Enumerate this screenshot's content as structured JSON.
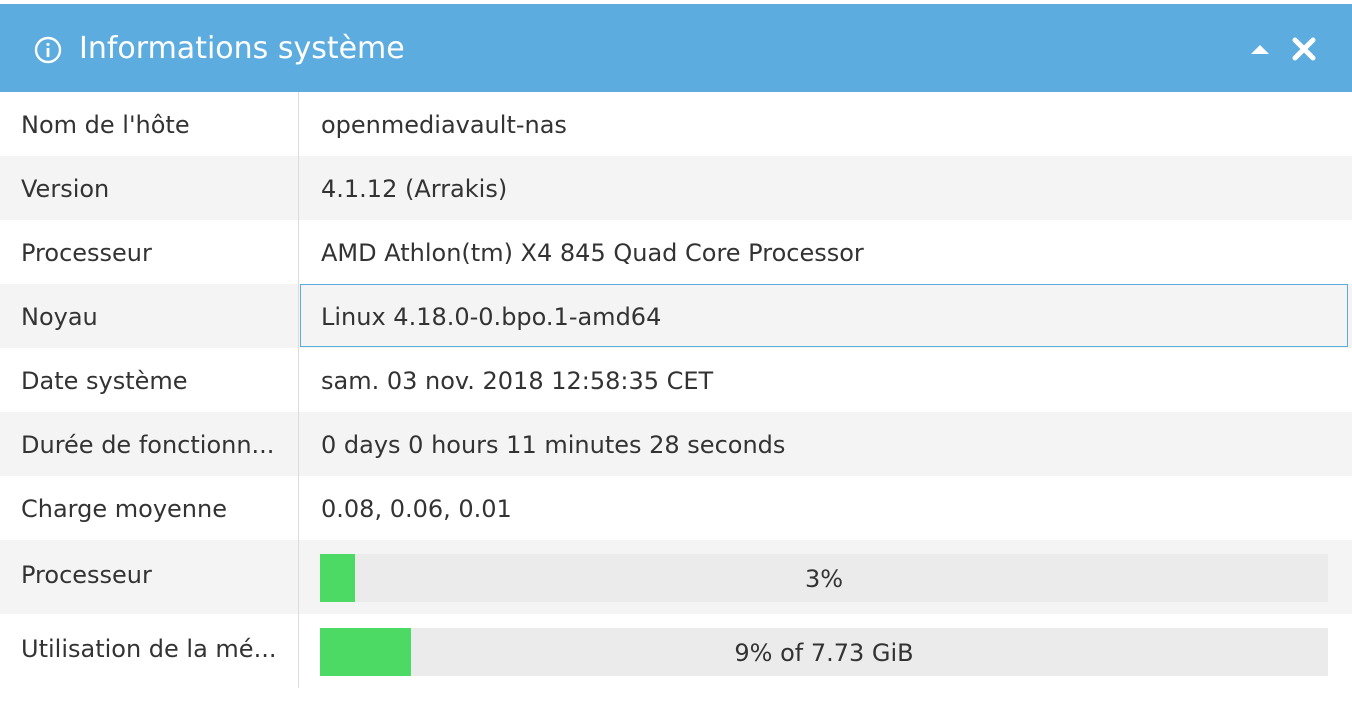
{
  "header": {
    "title": "Informations système",
    "accent_color": "#5dace0",
    "icons": {
      "info": "info-circle-icon",
      "collapse": "caret-up-icon",
      "close": "close-icon"
    }
  },
  "rows": [
    {
      "label": "Nom de l'hôte",
      "value": "openmediavault-nas"
    },
    {
      "label": "Version",
      "value": "4.1.12 (Arrakis)"
    },
    {
      "label": "Processeur",
      "value": "AMD Athlon(tm) X4 845 Quad Core Processor"
    },
    {
      "label": "Noyau",
      "value": "Linux 4.18.0-0.bpo.1-amd64"
    },
    {
      "label": "Date système",
      "value": "sam. 03 nov. 2018 12:58:35 CET"
    },
    {
      "label": "Durée de fonctionn...",
      "value": "0 days 0 hours 11 minutes 28 seconds"
    },
    {
      "label": "Charge moyenne",
      "value": "0.08, 0.06, 0.01"
    }
  ],
  "cpu_usage": {
    "label": "Processeur",
    "text": "3%",
    "fraction": 0.03
  },
  "memory_usage": {
    "label": "Utilisation de la mé...",
    "text": "9% of 7.73 GiB",
    "fraction": 0.09
  },
  "progress_color": "#4cd964"
}
